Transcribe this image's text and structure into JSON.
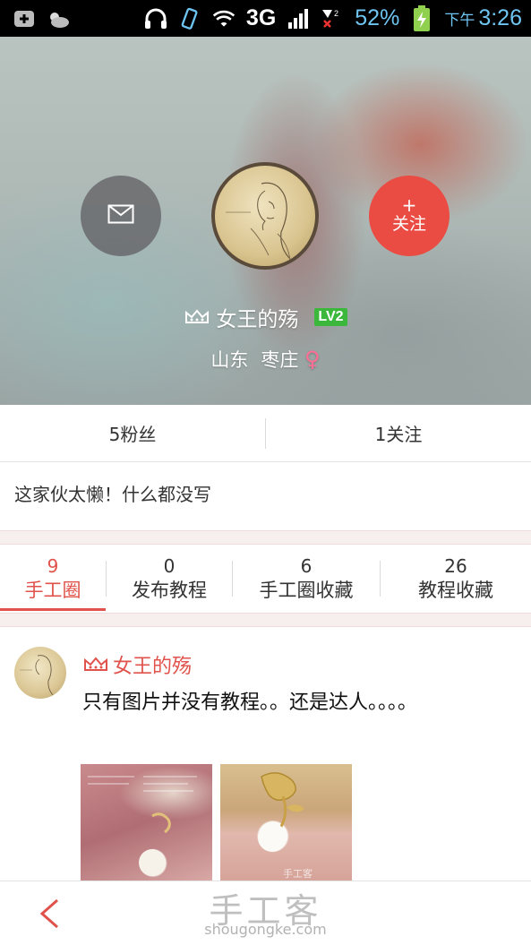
{
  "status_bar": {
    "network": "3G",
    "battery_percent": "52%",
    "time_prefix": "下午",
    "time": "3:26"
  },
  "profile": {
    "username": "女王的殇",
    "level_badge": "LV2",
    "province": "山东",
    "city": "枣庄",
    "gender_symbol": "♀",
    "message_icon": "envelope-icon",
    "follow_button": {
      "plus": "+",
      "label": "关注"
    }
  },
  "stats": {
    "fans": "5粉丝",
    "following": "1关注"
  },
  "bio": "这家伙太懒！什么都没写",
  "tabs": [
    {
      "count": "9",
      "label": "手工圈",
      "active": true
    },
    {
      "count": "0",
      "label": "发布教程",
      "active": false
    },
    {
      "count": "6",
      "label": "手工圈收藏",
      "active": false
    },
    {
      "count": "26",
      "label": "教程收藏",
      "active": false
    }
  ],
  "post": {
    "author": "女王的殇",
    "text": "只有图片并没有教程。。还是达人。。。。"
  },
  "bottom_bar": {
    "back_icon": "chevron-left-icon",
    "watermark_title": "手工客",
    "watermark_url": "shougongke.com"
  },
  "colors": {
    "accent_red": "#e0524b",
    "follow_button": "#ea4c43",
    "level_badge": "#3bb83b",
    "status_text_blue": "#6fc5f1"
  }
}
